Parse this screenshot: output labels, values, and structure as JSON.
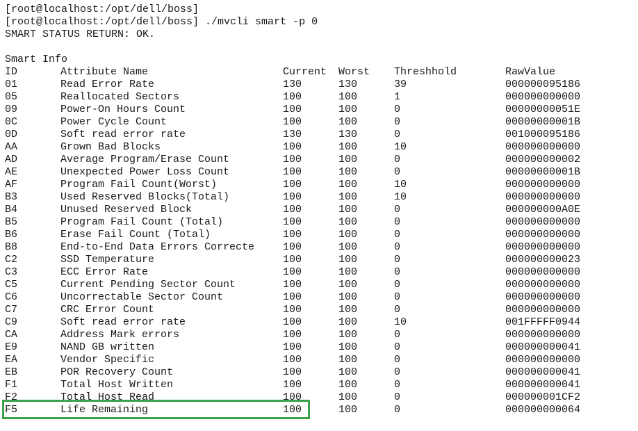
{
  "terminal": {
    "lines": [
      "[root@localhost:/opt/dell/boss]",
      "[root@localhost:/opt/dell/boss] ./mvcli smart -p 0",
      "SMART STATUS RETURN: OK."
    ],
    "section_title": "Smart Info",
    "headers": {
      "id": "ID",
      "name": "Attribute Name",
      "current": "Current",
      "worst": "Worst",
      "threshold": "Threshhold",
      "raw": "RawValue"
    },
    "rows": [
      {
        "id": "01",
        "name": "Read Error Rate",
        "current": "130",
        "worst": "130",
        "threshold": "39",
        "raw": "000000095186"
      },
      {
        "id": "05",
        "name": "Reallocated Sectors",
        "current": "100",
        "worst": "100",
        "threshold": "1",
        "raw": "000000000000"
      },
      {
        "id": "09",
        "name": "Power-On Hours Count",
        "current": "100",
        "worst": "100",
        "threshold": "0",
        "raw": "00000000051E"
      },
      {
        "id": "0C",
        "name": "Power Cycle Count",
        "current": "100",
        "worst": "100",
        "threshold": "0",
        "raw": "00000000001B"
      },
      {
        "id": "0D",
        "name": "Soft read error rate",
        "current": "130",
        "worst": "130",
        "threshold": "0",
        "raw": "001000095186"
      },
      {
        "id": "AA",
        "name": "Grown Bad Blocks",
        "current": "100",
        "worst": "100",
        "threshold": "10",
        "raw": "000000000000"
      },
      {
        "id": "AD",
        "name": "Average Program/Erase Count",
        "current": "100",
        "worst": "100",
        "threshold": "0",
        "raw": "000000000002"
      },
      {
        "id": "AE",
        "name": "Unexpected Power Loss Count",
        "current": "100",
        "worst": "100",
        "threshold": "0",
        "raw": "00000000001B"
      },
      {
        "id": "AF",
        "name": "Program Fail Count(Worst)",
        "current": "100",
        "worst": "100",
        "threshold": "10",
        "raw": "000000000000"
      },
      {
        "id": "B3",
        "name": "Used Reserved Blocks(Total)",
        "current": "100",
        "worst": "100",
        "threshold": "10",
        "raw": "000000000000"
      },
      {
        "id": "B4",
        "name": "Unused Reserved Block",
        "current": "100",
        "worst": "100",
        "threshold": "0",
        "raw": "000000000A0E"
      },
      {
        "id": "B5",
        "name": "Program Fail Count (Total)",
        "current": "100",
        "worst": "100",
        "threshold": "0",
        "raw": "000000000000"
      },
      {
        "id": "B6",
        "name": "Erase Fail Count (Total)",
        "current": "100",
        "worst": "100",
        "threshold": "0",
        "raw": "000000000000"
      },
      {
        "id": "B8",
        "name": "End-to-End Data Errors Correcte",
        "current": "100",
        "worst": "100",
        "threshold": "0",
        "raw": "000000000000"
      },
      {
        "id": "C2",
        "name": "SSD Temperature",
        "current": "100",
        "worst": "100",
        "threshold": "0",
        "raw": "000000000023"
      },
      {
        "id": "C3",
        "name": "ECC Error Rate",
        "current": "100",
        "worst": "100",
        "threshold": "0",
        "raw": "000000000000"
      },
      {
        "id": "C5",
        "name": "Current Pending Sector Count",
        "current": "100",
        "worst": "100",
        "threshold": "0",
        "raw": "000000000000"
      },
      {
        "id": "C6",
        "name": "Uncorrectable Sector Count",
        "current": "100",
        "worst": "100",
        "threshold": "0",
        "raw": "000000000000"
      },
      {
        "id": "C7",
        "name": "CRC Error Count",
        "current": "100",
        "worst": "100",
        "threshold": "0",
        "raw": "000000000000"
      },
      {
        "id": "C9",
        "name": "Soft read error rate",
        "current": "100",
        "worst": "100",
        "threshold": "10",
        "raw": "001FFFFF0944"
      },
      {
        "id": "CA",
        "name": "Address Mark errors",
        "current": "100",
        "worst": "100",
        "threshold": "0",
        "raw": "000000000000"
      },
      {
        "id": "E9",
        "name": "NAND GB written",
        "current": "100",
        "worst": "100",
        "threshold": "0",
        "raw": "000000000041"
      },
      {
        "id": "EA",
        "name": "Vendor Specific",
        "current": "100",
        "worst": "100",
        "threshold": "0",
        "raw": "000000000000"
      },
      {
        "id": "EB",
        "name": "POR Recovery Count",
        "current": "100",
        "worst": "100",
        "threshold": "0",
        "raw": "000000000041"
      },
      {
        "id": "F1",
        "name": "Total Host Written",
        "current": "100",
        "worst": "100",
        "threshold": "0",
        "raw": "000000000041"
      },
      {
        "id": "F2",
        "name": "Total Host Read",
        "current": "100",
        "worst": "100",
        "threshold": "0",
        "raw": "000000001CF2"
      },
      {
        "id": "F5",
        "name": "Life Remaining",
        "current": "100",
        "worst": "100",
        "threshold": "0",
        "raw": "000000000064"
      }
    ]
  },
  "highlight": {
    "color": "#3aa24a"
  }
}
